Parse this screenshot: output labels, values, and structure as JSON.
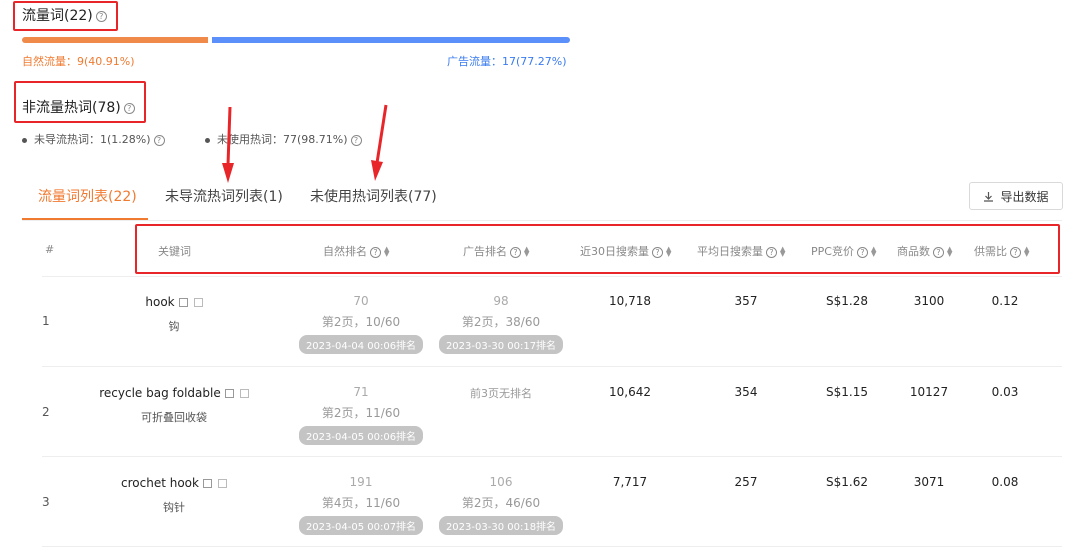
{
  "traffic": {
    "title": "流量词(22)",
    "organic_label": "自然流量：9(40.91%)",
    "ad_label": "广告流量：17(77.27%)",
    "organic_share": 0.4091,
    "colors": {
      "organic": "#f08a4b",
      "ad": "#5b8ff9",
      "highlight": "#e8262a"
    }
  },
  "non_traffic": {
    "title": "非流量热词(78)",
    "stat_1": "未导流热词：1(1.28%)",
    "stat_2": "未使用热词：77(98.71%)"
  },
  "tabs": [
    "流量词列表(22)",
    "未导流热词列表(1)",
    "未使用热词列表(77)"
  ],
  "export_label": "导出数据",
  "table": {
    "headers": [
      "#",
      "关键词",
      "自然排名",
      "广告排名",
      "近30日搜索量",
      "平均日搜索量",
      "PPC竞价",
      "商品数",
      "供需比"
    ],
    "rows": [
      {
        "index": "1",
        "keyword": "hook",
        "keyword_cn": "钩",
        "organic_rank": "70",
        "organic_page": "第2页，10/60",
        "organic_time": "2023-04-04 00:06排名",
        "ad_rank": "98",
        "ad_page": "第2页，38/60",
        "ad_time": "2023-03-30 00:17排名",
        "search_30d": "10,718",
        "daily_search": "357",
        "ppc": "S$1.28",
        "products": "3100",
        "ratio": "0.12"
      },
      {
        "index": "2",
        "keyword": "recycle bag foldable",
        "keyword_cn": "可折叠回收袋",
        "organic_rank": "71",
        "organic_page": "第2页，11/60",
        "organic_time": "2023-04-05 00:06排名",
        "ad_none": "前3页无排名",
        "search_30d": "10,642",
        "daily_search": "354",
        "ppc": "S$1.15",
        "products": "10127",
        "ratio": "0.03"
      },
      {
        "index": "3",
        "keyword": "crochet hook",
        "keyword_cn": "钩针",
        "organic_rank": "191",
        "organic_page": "第4页，11/60",
        "organic_time": "2023-04-05 00:07排名",
        "ad_rank": "106",
        "ad_page": "第2页，46/60",
        "ad_time": "2023-03-30 00:18排名",
        "search_30d": "7,717",
        "daily_search": "257",
        "ppc": "S$1.62",
        "products": "3071",
        "ratio": "0.08"
      }
    ]
  }
}
